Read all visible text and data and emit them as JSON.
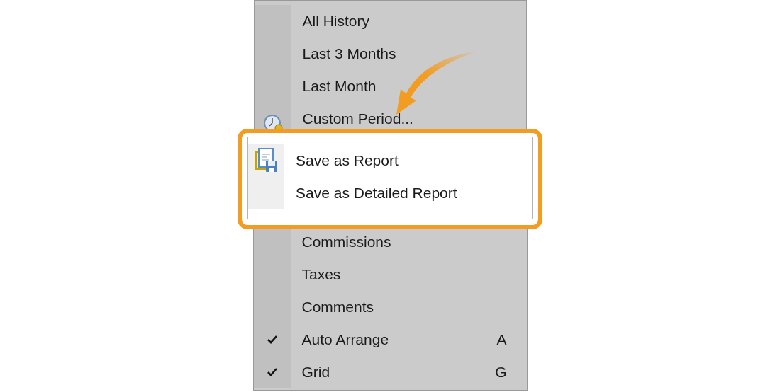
{
  "menu": {
    "sections": [
      {
        "highlighted": false,
        "items": [
          {
            "label": "All History",
            "kind": "text",
            "checked": false
          },
          {
            "label": "Last 3 Months",
            "kind": "text",
            "checked": false
          },
          {
            "label": "Last Month",
            "kind": "text",
            "checked": false
          },
          {
            "label": "Custom Period...",
            "kind": "icon",
            "checked": false
          }
        ]
      },
      {
        "highlighted": true,
        "items": [
          {
            "label": "Save as Report",
            "kind": "icon",
            "checked": false
          },
          {
            "label": "Save as Detailed Report",
            "kind": "text",
            "checked": false
          }
        ]
      },
      {
        "highlighted": false,
        "items": [
          {
            "label": "Commissions",
            "kind": "text",
            "checked": false
          },
          {
            "label": "Taxes",
            "kind": "text",
            "checked": false
          },
          {
            "label": "Comments",
            "kind": "text",
            "checked": false
          },
          {
            "label": "Auto Arrange",
            "kind": "text",
            "checked": true,
            "shortcut": "A"
          },
          {
            "label": "Grid",
            "kind": "text",
            "checked": true,
            "shortcut": "G"
          }
        ]
      }
    ]
  },
  "callout_arrow": true
}
